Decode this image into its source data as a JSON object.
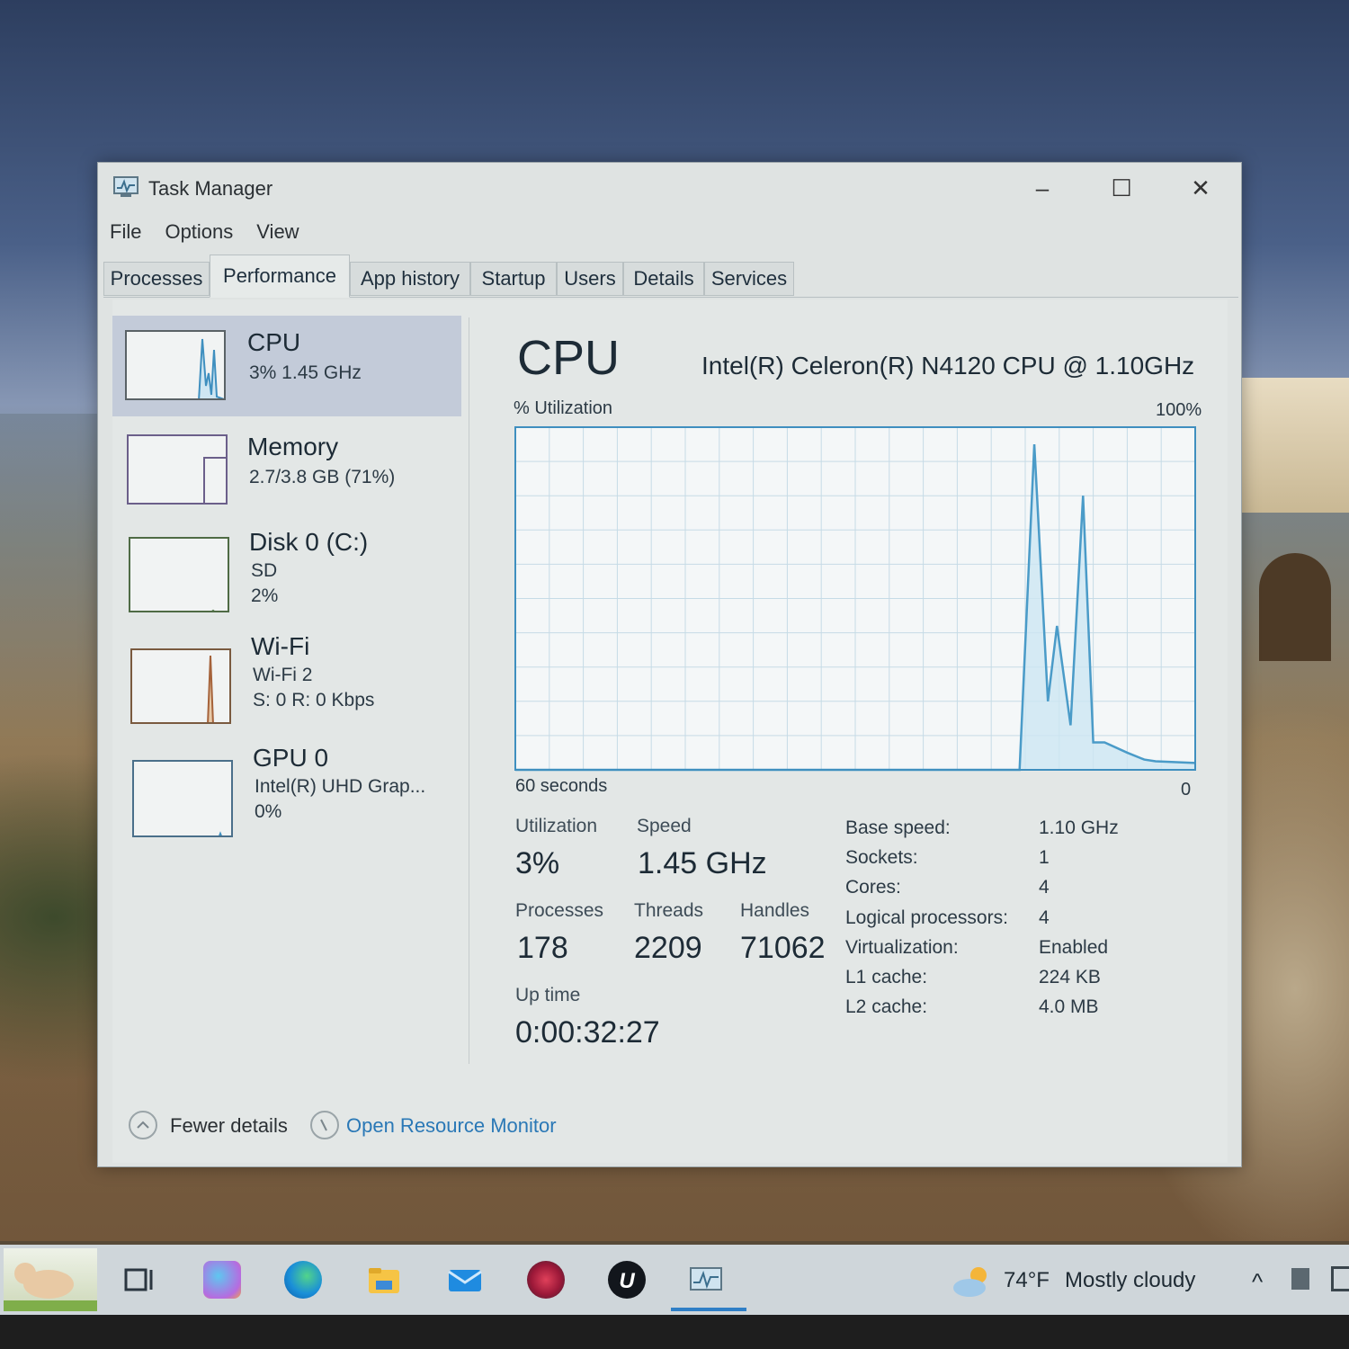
{
  "window": {
    "title": "Task Manager",
    "controls": {
      "minimize": "–",
      "maximize": "☐",
      "close": "✕"
    }
  },
  "menu": [
    "File",
    "Options",
    "View"
  ],
  "tabs": [
    {
      "label": "Processes",
      "active": false
    },
    {
      "label": "Performance",
      "active": true
    },
    {
      "label": "App history",
      "active": false
    },
    {
      "label": "Startup",
      "active": false
    },
    {
      "label": "Users",
      "active": false
    },
    {
      "label": "Details",
      "active": false
    },
    {
      "label": "Services",
      "active": false
    }
  ],
  "sidebar": [
    {
      "title": "CPU",
      "lines": [
        "3%  1.45 GHz"
      ],
      "selected": true
    },
    {
      "title": "Memory",
      "lines": [
        "2.7/3.8 GB (71%)"
      ],
      "selected": false
    },
    {
      "title": "Disk 0 (C:)",
      "lines": [
        "SD",
        "2%"
      ],
      "selected": false
    },
    {
      "title": "Wi-Fi",
      "lines": [
        "Wi-Fi 2",
        "S: 0  R: 0 Kbps"
      ],
      "selected": false
    },
    {
      "title": "GPU 0",
      "lines": [
        "Intel(R) UHD Grap...",
        "0%"
      ],
      "selected": false
    }
  ],
  "main": {
    "heading": "CPU",
    "model": "Intel(R) Celeron(R) N4120 CPU @ 1.10GHz",
    "graph_top_left": "% Utilization",
    "graph_top_right": "100%",
    "graph_bottom_left": "60 seconds",
    "graph_bottom_right": "0",
    "stats": {
      "utilization_label": "Utilization",
      "utilization": "3%",
      "speed_label": "Speed",
      "speed": "1.45 GHz",
      "processes_label": "Processes",
      "processes": "178",
      "threads_label": "Threads",
      "threads": "2209",
      "handles_label": "Handles",
      "handles": "71062",
      "uptime_label": "Up time",
      "uptime": "0:00:32:27"
    },
    "specs": [
      {
        "label": "Base speed:",
        "value": "1.10 GHz"
      },
      {
        "label": "Sockets:",
        "value": "1"
      },
      {
        "label": "Cores:",
        "value": "4"
      },
      {
        "label": "Logical processors:",
        "value": "4"
      },
      {
        "label": "Virtualization:",
        "value": "Enabled"
      },
      {
        "label": "L1 cache:",
        "value": "224 KB"
      },
      {
        "label": "L2 cache:",
        "value": "4.0 MB"
      }
    ]
  },
  "footer": {
    "fewer_details": "Fewer details",
    "open_resource_monitor": "Open Resource Monitor"
  },
  "chart_data": {
    "type": "area",
    "x": [
      60,
      59,
      56,
      55,
      53,
      52,
      51,
      50,
      49,
      48,
      47,
      46,
      45,
      44,
      42,
      40,
      38,
      36,
      34,
      32,
      30,
      28,
      26,
      24,
      22,
      20,
      18,
      16,
      14,
      12,
      11,
      10,
      9,
      8,
      7,
      6,
      5,
      4,
      3,
      2,
      1,
      0
    ],
    "series": [
      {
        "values": [
          0,
          0,
          0,
          0,
          0,
          0,
          0,
          0,
          0,
          0,
          0,
          0,
          0,
          0,
          0,
          0,
          0,
          0,
          0,
          0,
          0,
          0,
          0,
          0,
          0,
          0,
          0,
          0,
          0,
          0,
          0,
          0,
          0,
          0,
          0,
          0,
          0,
          0,
          0,
          0,
          0,
          0
        ]
      }
    ],
    "cpu_trace": [
      [
        60,
        0
      ],
      [
        15.5,
        0
      ],
      [
        14.2,
        95
      ],
      [
        13.0,
        20
      ],
      [
        12.2,
        42
      ],
      [
        11.0,
        13
      ],
      [
        9.9,
        80
      ],
      [
        9.0,
        8
      ],
      [
        8.0,
        8
      ],
      [
        6.0,
        5
      ],
      [
        4.5,
        3
      ],
      [
        3.5,
        2.5
      ],
      [
        0,
        2
      ]
    ],
    "ylim": [
      0,
      100
    ],
    "xlim": [
      60,
      0
    ],
    "grid": true,
    "color": "#4a9bc8"
  },
  "taskbar": {
    "weather_temp": "74°F",
    "weather_text": "Mostly cloudy",
    "chevron": "^"
  }
}
